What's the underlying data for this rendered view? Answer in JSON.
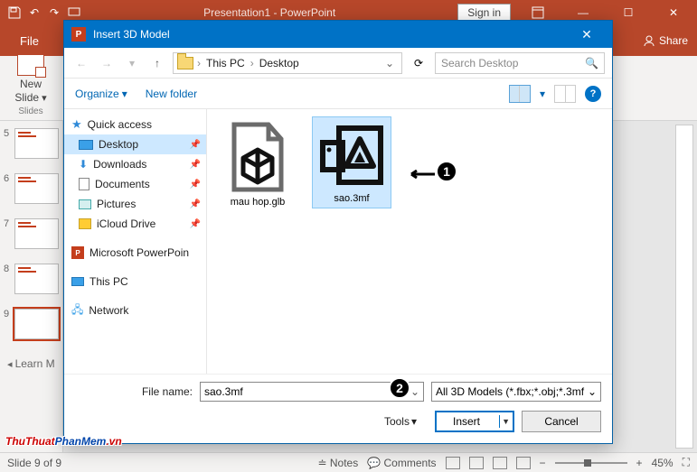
{
  "app": {
    "title": "Presentation1 - PowerPoint",
    "signin": "Sign in",
    "file_tab": "File",
    "share": "Share",
    "newslide_l1": "New",
    "newslide_l2": "Slide",
    "group_slides": "Slides",
    "learn_more": "Learn M",
    "status_left": "Slide 9 of 9",
    "status_notes": "Notes",
    "status_comments": "Comments",
    "zoom": "45%"
  },
  "thumbs": [
    "5",
    "6",
    "7",
    "8",
    "9"
  ],
  "dlg": {
    "title": "Insert 3D Model",
    "breadcrumb": {
      "seg1": "This PC",
      "seg2": "Desktop"
    },
    "search_placeholder": "Search Desktop",
    "organize": "Organize",
    "newfolder": "New folder",
    "tree": {
      "quick": "Quick access",
      "desktop": "Desktop",
      "downloads": "Downloads",
      "documents": "Documents",
      "pictures": "Pictures",
      "icloud": "iCloud Drive",
      "mspp": "Microsoft PowerPoin",
      "thispc": "This PC",
      "network": "Network"
    },
    "files": {
      "f1": "mau hop.glb",
      "f2": "sao.3mf"
    },
    "filename_label": "File name:",
    "filename_value": "sao.3mf",
    "filter": "All 3D Models (*.fbx;*.obj;*.3mf",
    "tools": "Tools",
    "insert": "Insert",
    "cancel": "Cancel"
  },
  "annotations": {
    "a1": "1",
    "a2": "2"
  },
  "watermark": {
    "part1": "ThuThuat",
    "part2": "PhanMem",
    "part3": ".vn"
  }
}
